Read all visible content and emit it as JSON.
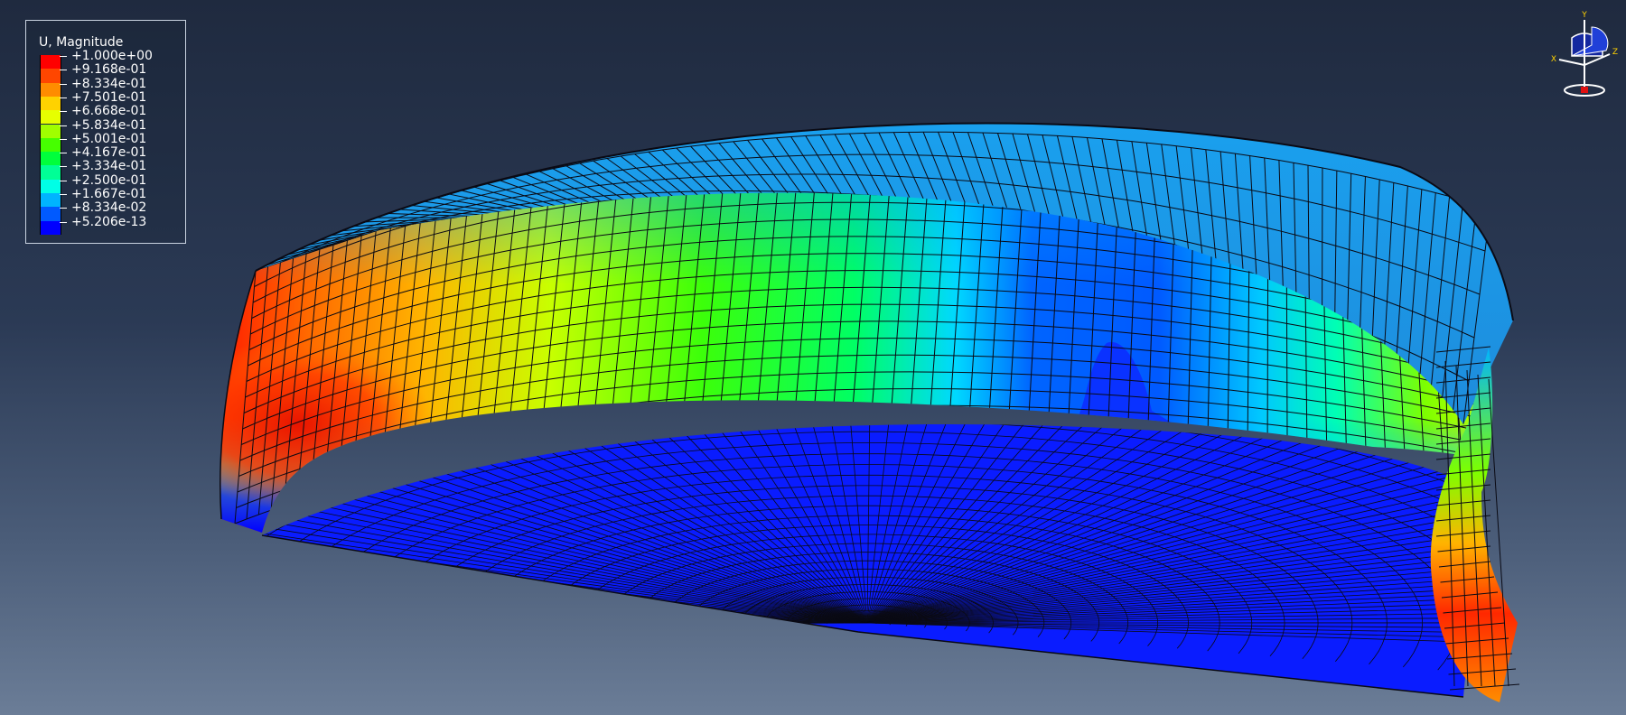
{
  "legend": {
    "title": "U, Magnitude",
    "levels": [
      {
        "label": "+1.000e+00",
        "color": "#ff0000"
      },
      {
        "label": "+9.168e-01",
        "color": "#ff4600"
      },
      {
        "label": "+8.334e-01",
        "color": "#ff8c00"
      },
      {
        "label": "+7.501e-01",
        "color": "#ffd200"
      },
      {
        "label": "+6.668e-01",
        "color": "#e6ff00"
      },
      {
        "label": "+5.834e-01",
        "color": "#a0ff00"
      },
      {
        "label": "+5.001e-01",
        "color": "#46ff00"
      },
      {
        "label": "+4.167e-01",
        "color": "#00ff3c"
      },
      {
        "label": "+3.334e-01",
        "color": "#00ff96"
      },
      {
        "label": "+2.500e-01",
        "color": "#00ffe6"
      },
      {
        "label": "+1.667e-01",
        "color": "#00b4ff"
      },
      {
        "label": "+8.334e-02",
        "color": "#005aff"
      },
      {
        "label": "+5.206e-13",
        "color": "#0000ff"
      }
    ]
  },
  "triad": {
    "axis_y": "Y",
    "axis_x": "X",
    "axis_z": "Z"
  },
  "colors": {
    "background_top": "#1f2a3f",
    "background_bottom": "#6b7d97",
    "mesh_lines": "#0a0a14"
  }
}
